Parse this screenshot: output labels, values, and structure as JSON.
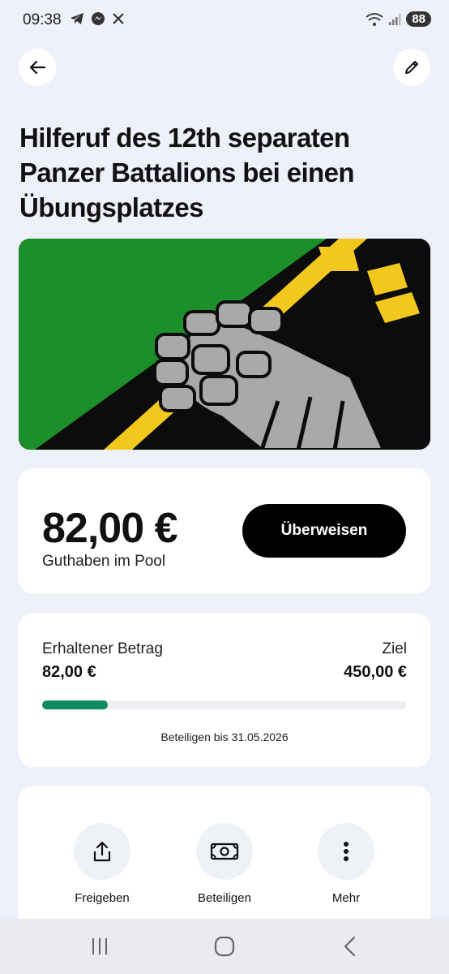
{
  "status_bar": {
    "time": "09:38",
    "battery": "88",
    "left_icons": [
      "telegram-icon",
      "messenger-icon",
      "x-icon"
    ],
    "right_icons": [
      "wifi-icon",
      "signal-icon"
    ]
  },
  "header": {
    "back_icon": "arrow-left-icon",
    "edit_icon": "pencil-icon"
  },
  "page": {
    "title": "Hilferuf des 12th separaten Panzer Battalions bei einen Übungsplatzes"
  },
  "hero_image": {
    "description_colors": {
      "green": "#1d8f2a",
      "black": "#0c0c0c",
      "yellow": "#f2c81c",
      "gray": "#a9a9a9"
    }
  },
  "balance": {
    "amount": "82,00 €",
    "label": "Guthaben im Pool",
    "transfer_label": "Überweisen"
  },
  "progress": {
    "received_label": "Erhaltener Betrag",
    "received_value": "82,00 €",
    "goal_label": "Ziel",
    "goal_value": "450,00 €",
    "fraction": 0.18,
    "deadline": "Beteiligen bis 31.05.2026",
    "accent": "#0f8a63"
  },
  "actions": [
    {
      "label": "Freigeben",
      "icon": "share-icon"
    },
    {
      "label": "Beteiligen",
      "icon": "banknote-icon"
    },
    {
      "label": "Mehr",
      "icon": "more-vertical-icon"
    }
  ],
  "nav": {
    "icons": [
      "recent-apps-icon",
      "home-icon",
      "back-icon"
    ]
  }
}
